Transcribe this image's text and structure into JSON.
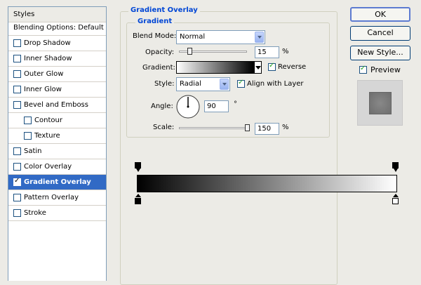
{
  "styles_panel": {
    "header": "Styles",
    "items": [
      {
        "label": "Blending Options: Default",
        "has_checkbox": false,
        "checked": false
      },
      {
        "label": "Drop Shadow",
        "has_checkbox": true,
        "checked": false
      },
      {
        "label": "Inner Shadow",
        "has_checkbox": true,
        "checked": false
      },
      {
        "label": "Outer Glow",
        "has_checkbox": true,
        "checked": false
      },
      {
        "label": "Inner Glow",
        "has_checkbox": true,
        "checked": false
      },
      {
        "label": "Bevel and Emboss",
        "has_checkbox": true,
        "checked": false
      },
      {
        "label": "Contour",
        "has_checkbox": true,
        "checked": false
      },
      {
        "label": "Texture",
        "has_checkbox": true,
        "checked": false
      },
      {
        "label": "Satin",
        "has_checkbox": true,
        "checked": false
      },
      {
        "label": "Color Overlay",
        "has_checkbox": true,
        "checked": false
      },
      {
        "label": "Gradient Overlay",
        "has_checkbox": true,
        "checked": true,
        "selected": true
      },
      {
        "label": "Pattern Overlay",
        "has_checkbox": true,
        "checked": false
      },
      {
        "label": "Stroke",
        "has_checkbox": true,
        "checked": false
      }
    ]
  },
  "gradient_overlay": {
    "title": "Gradient Overlay",
    "section_title": "Gradient",
    "blend_mode_label": "Blend Mode:",
    "blend_mode_value": "Normal",
    "opacity_label": "Opacity:",
    "opacity_value": "15",
    "opacity_level": 15,
    "percent": "%",
    "gradient_label": "Gradient:",
    "reverse_label": "Reverse",
    "reverse_checked": true,
    "style_label": "Style:",
    "style_value": "Radial",
    "align_label": "Align with Layer",
    "align_checked": true,
    "angle_label": "Angle:",
    "angle_value": "90",
    "degree": "°",
    "scale_label": "Scale:",
    "scale_value": "150",
    "scale_level_fraction": 1.0
  },
  "buttons": {
    "ok": "OK",
    "cancel": "Cancel",
    "new_style": "New Style...",
    "preview_label": "Preview",
    "preview_checked": true
  },
  "colors": {
    "accent": "#0046d5",
    "selection": "#316ac5",
    "gradient_start": "#000000",
    "gradient_end": "#ffffff"
  }
}
